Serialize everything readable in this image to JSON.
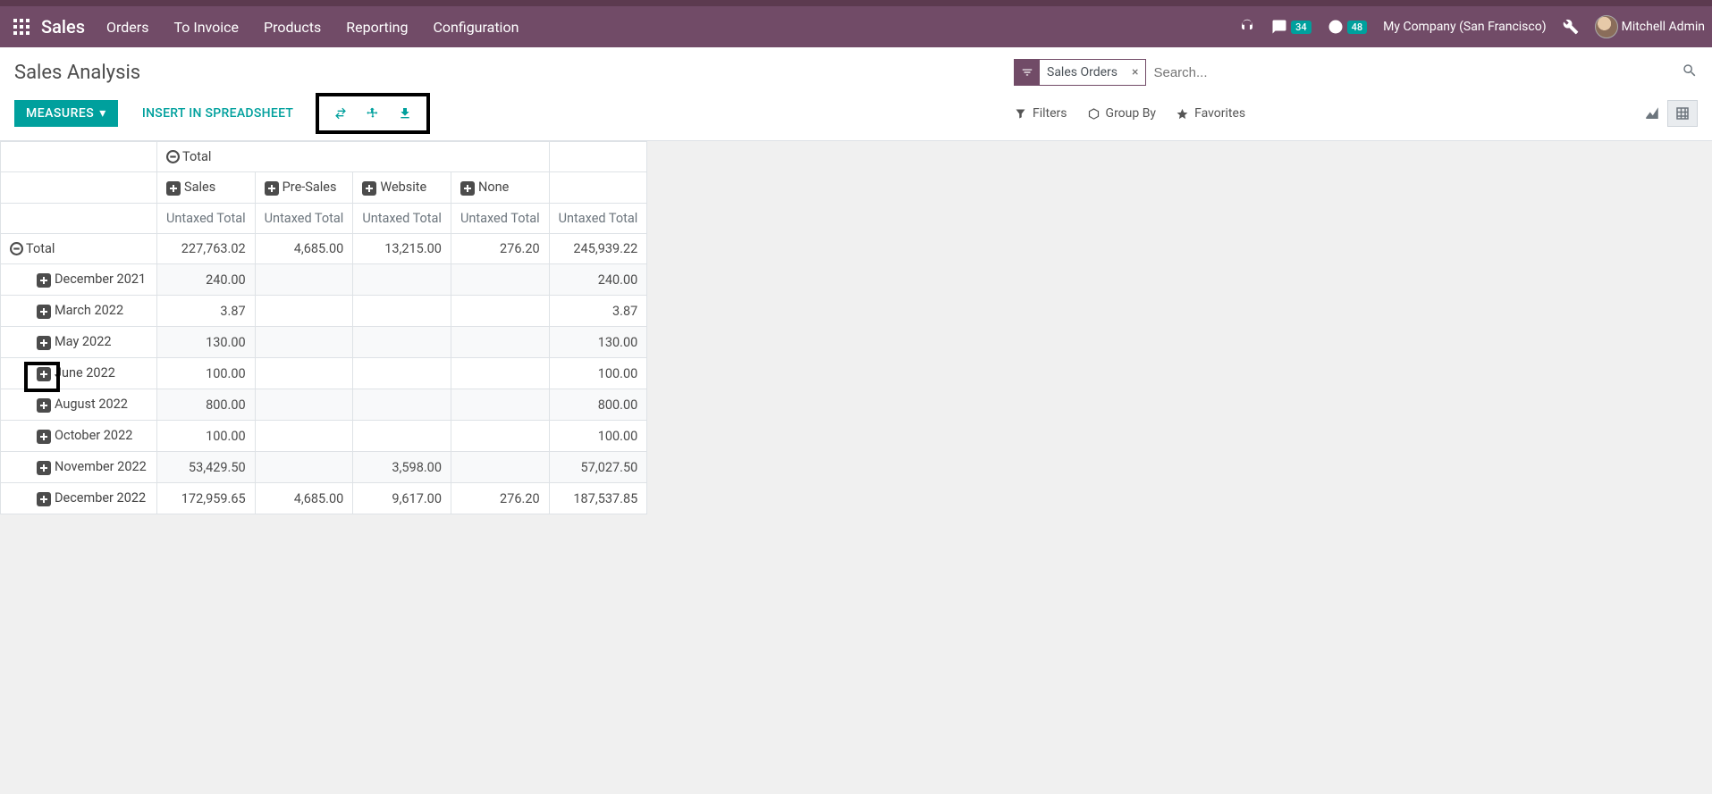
{
  "topbar": {
    "module": "Sales",
    "nav": [
      "Orders",
      "To Invoice",
      "Products",
      "Reporting",
      "Configuration"
    ],
    "messages_count": "34",
    "activities_count": "48",
    "company": "My Company (San Francisco)",
    "user": "Mitchell Admin"
  },
  "page": {
    "title": "Sales Analysis",
    "measures_btn": "Measures",
    "insert_btn": "Insert in Spreadsheet",
    "search_facet": "Sales Orders",
    "search_placeholder": "Search...",
    "filters": "Filters",
    "groupby": "Group By",
    "favorites": "Favorites"
  },
  "pivot": {
    "total_label": "Total",
    "col_headers": [
      "Sales",
      "Pre-Sales",
      "Website",
      "None"
    ],
    "measure_label": "Untaxed Total",
    "rows": [
      {
        "label": "Total",
        "level": 0,
        "expanded": true,
        "values": [
          "227,763.02",
          "4,685.00",
          "13,215.00",
          "276.20",
          "245,939.22"
        ]
      },
      {
        "label": "December 2021",
        "level": 1,
        "expanded": false,
        "values": [
          "240.00",
          "",
          "",
          "",
          "240.00"
        ]
      },
      {
        "label": "March 2022",
        "level": 1,
        "expanded": false,
        "values": [
          "3.87",
          "",
          "",
          "",
          "3.87"
        ]
      },
      {
        "label": "May 2022",
        "level": 1,
        "expanded": false,
        "values": [
          "130.00",
          "",
          "",
          "",
          "130.00"
        ]
      },
      {
        "label": "June 2022",
        "level": 1,
        "expanded": false,
        "values": [
          "100.00",
          "",
          "",
          "",
          "100.00"
        ],
        "highlight": true
      },
      {
        "label": "August 2022",
        "level": 1,
        "expanded": false,
        "values": [
          "800.00",
          "",
          "",
          "",
          "800.00"
        ]
      },
      {
        "label": "October 2022",
        "level": 1,
        "expanded": false,
        "values": [
          "100.00",
          "",
          "",
          "",
          "100.00"
        ]
      },
      {
        "label": "November 2022",
        "level": 1,
        "expanded": false,
        "values": [
          "53,429.50",
          "",
          "3,598.00",
          "",
          "57,027.50"
        ]
      },
      {
        "label": "December 2022",
        "level": 1,
        "expanded": false,
        "values": [
          "172,959.65",
          "4,685.00",
          "9,617.00",
          "276.20",
          "187,537.85"
        ]
      }
    ]
  }
}
